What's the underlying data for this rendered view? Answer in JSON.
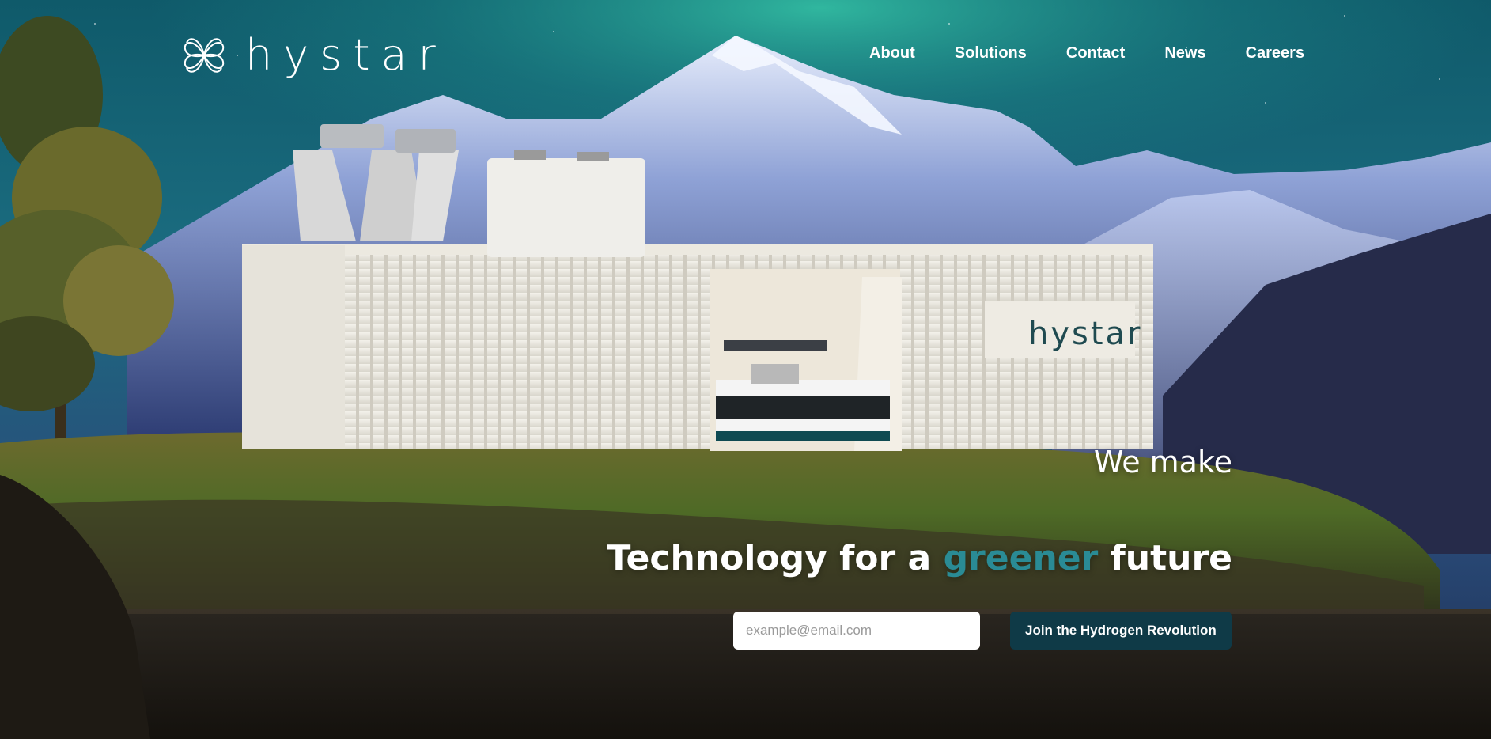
{
  "brand": {
    "name": "hystar",
    "logo_icon": "clover-loop-icon",
    "container_wordmark": "hystar"
  },
  "nav": {
    "items": [
      "About",
      "Solutions",
      "Contact",
      "News",
      "Careers"
    ]
  },
  "hero": {
    "eyebrow": "We make",
    "headline_part1": "Technology for a ",
    "headline_accent": "greener",
    "headline_part2": " future",
    "email_placeholder": "example@email.com",
    "cta_label": "Join the Hydrogen Revolution"
  },
  "colors": {
    "accent": "#2a8b95",
    "cta_bg": "#0f3a47",
    "text": "#ffffff"
  }
}
